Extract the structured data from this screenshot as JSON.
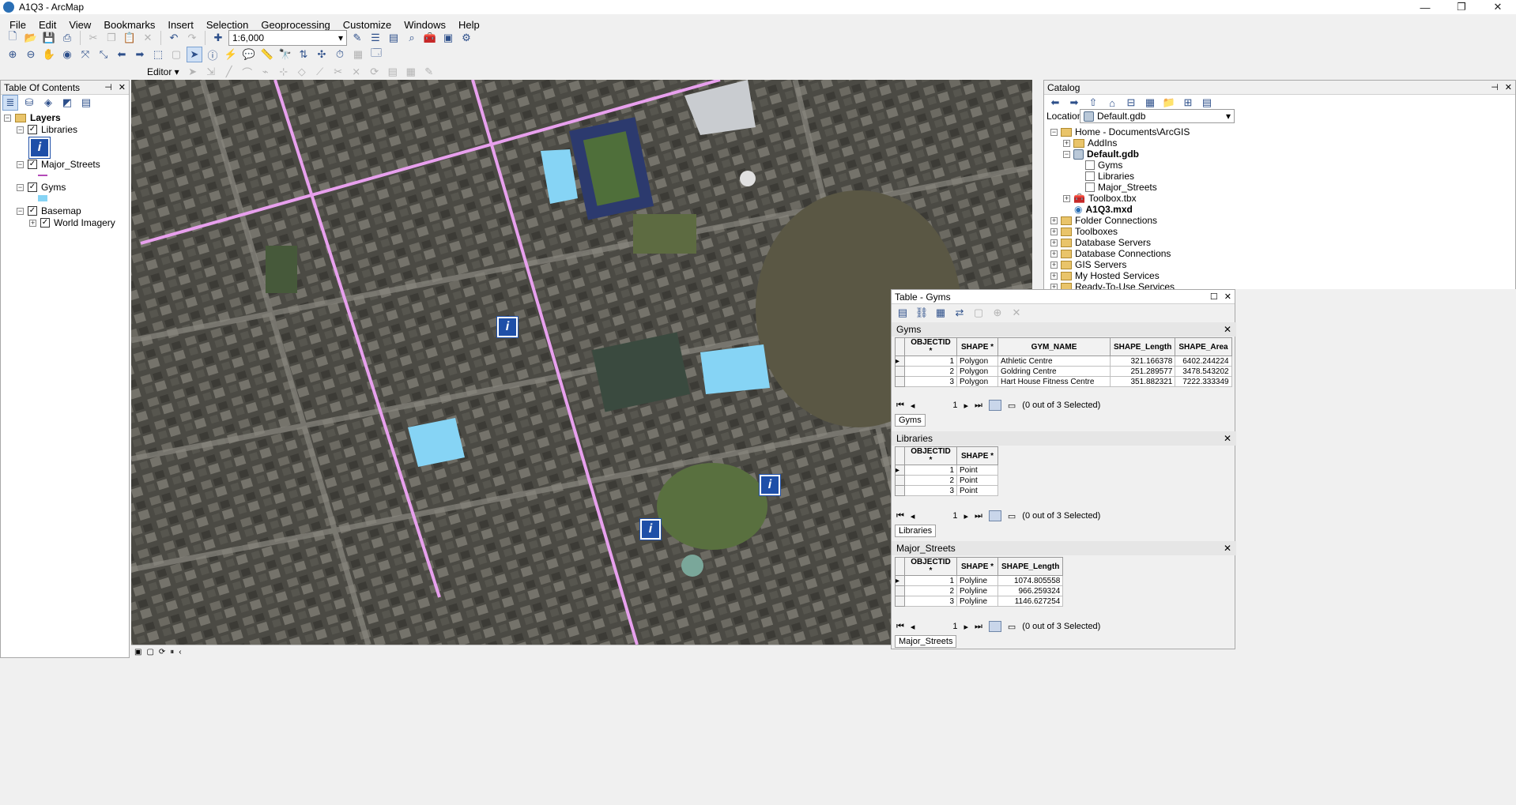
{
  "window": {
    "title": "A1Q3 - ArcMap"
  },
  "menu": [
    "File",
    "Edit",
    "View",
    "Bookmarks",
    "Insert",
    "Selection",
    "Geoprocessing",
    "Customize",
    "Windows",
    "Help"
  ],
  "toolbar": {
    "scale": "1:6,000",
    "editor_label": "Editor ▾"
  },
  "toc": {
    "title": "Table Of Contents",
    "root": "Layers",
    "layers": [
      {
        "name": "Libraries"
      },
      {
        "name": "Major_Streets"
      },
      {
        "name": "Gyms"
      },
      {
        "name": "Basemap",
        "child": "World Imagery"
      }
    ]
  },
  "catalog": {
    "title": "Catalog",
    "location_label": "Location:",
    "location_value": "Default.gdb",
    "tree": {
      "home": "Home - Documents\\ArcGIS",
      "addins": "AddIns",
      "gdb": "Default.gdb",
      "gdb_items": [
        "Gyms",
        "Libraries",
        "Major_Streets"
      ],
      "toolbox": "Toolbox.tbx",
      "mxd": "A1Q3.mxd",
      "top": [
        "Folder Connections",
        "Toolboxes",
        "Database Servers",
        "Database Connections",
        "GIS Servers",
        "My Hosted Services",
        "Ready-To-Use Services"
      ]
    }
  },
  "table_window": {
    "title": "Table - Gyms",
    "gyms": {
      "name": "Gyms",
      "columns": [
        "OBJECTID *",
        "SHAPE *",
        "GYM_NAME",
        "SHAPE_Length",
        "SHAPE_Area"
      ],
      "rows": [
        [
          "1",
          "Polygon",
          "Athletic Centre",
          "321.166378",
          "6402.244224"
        ],
        [
          "2",
          "Polygon",
          "Goldring Centre",
          "251.289577",
          "3478.543202"
        ],
        [
          "3",
          "Polygon",
          "Hart House Fitness Centre",
          "351.882321",
          "7222.333349"
        ]
      ],
      "page": "1",
      "selected": "(0 out of 3 Selected)",
      "tab": "Gyms"
    },
    "libraries": {
      "name": "Libraries",
      "columns": [
        "OBJECTID *",
        "SHAPE *"
      ],
      "rows": [
        [
          "1",
          "Point"
        ],
        [
          "2",
          "Point"
        ],
        [
          "3",
          "Point"
        ]
      ],
      "page": "1",
      "selected": "(0 out of 3 Selected)",
      "tab": "Libraries"
    },
    "streets": {
      "name": "Major_Streets",
      "columns": [
        "OBJECTID *",
        "SHAPE *",
        "SHAPE_Length"
      ],
      "rows": [
        [
          "1",
          "Polyline",
          "1074.805558"
        ],
        [
          "2",
          "Polyline",
          "966.259324"
        ],
        [
          "3",
          "Polyline",
          "1146.627254"
        ]
      ],
      "page": "1",
      "selected": "(0 out of 3 Selected)",
      "tab": "Major_Streets"
    }
  },
  "map": {
    "library_marker": "i",
    "street_color": "#e8a0ee",
    "gym_color": "#86d4f5"
  }
}
